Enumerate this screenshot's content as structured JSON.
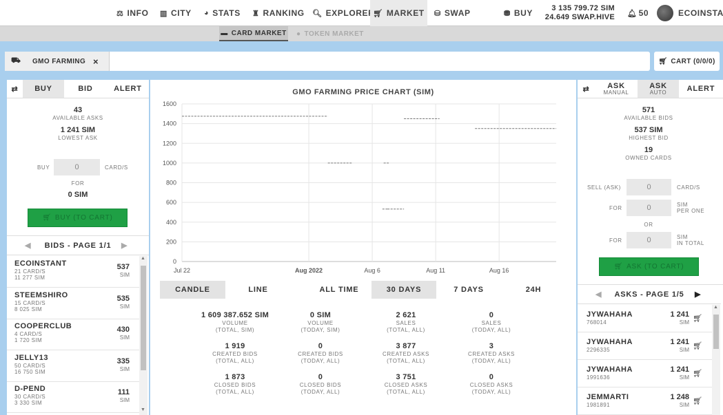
{
  "nav": {
    "items": [
      {
        "label": "INFO",
        "icon": "scale-icon"
      },
      {
        "label": "CITY",
        "icon": "city-icon"
      },
      {
        "label": "STATS",
        "icon": "pie-chart-icon"
      },
      {
        "label": "RANKING",
        "icon": "trophy-icon"
      },
      {
        "label": "EXPLORER",
        "icon": "search-icon"
      },
      {
        "label": "MARKET",
        "icon": "cart-icon"
      },
      {
        "label": "SWAP",
        "icon": "coins-icon"
      }
    ],
    "buy_label": "BUY",
    "balance_sim": "3 135 799.72 SIM",
    "balance_swap": "24.649 SWAP.HIVE",
    "notif_count": "50",
    "username": "ECOINSTAN"
  },
  "subnav": {
    "card_market": "CARD MARKET",
    "token_market": "TOKEN MARKET"
  },
  "filter": {
    "tag_label": "GMO FARMING",
    "clear": "×",
    "search_placeholder": "",
    "cart_label": "CART (0/0/0)"
  },
  "left": {
    "tabs": [
      "BUY",
      "BID",
      "ALERT"
    ],
    "available_asks": "43",
    "available_asks_label": "AVAILABLE ASKS",
    "lowest_ask": "1 241 SIM",
    "lowest_ask_label": "LOWEST ASK",
    "buy_label": "BUY",
    "buy_value": "0",
    "cards_label": "CARD/S",
    "for_label": "FOR",
    "total": "0 SIM",
    "buy_button": "BUY (TO CART)",
    "pager": "BIDS - PAGE 1/1",
    "bids": [
      {
        "name": "ECOINSTANT",
        "cards": "21 CARD/S",
        "total": "11 277 SIM",
        "price": "537",
        "unit": "SIM"
      },
      {
        "name": "STEEMSHIRO",
        "cards": "15 CARD/S",
        "total": "8 025 SIM",
        "price": "535",
        "unit": "SIM"
      },
      {
        "name": "COOPERCLUB",
        "cards": "4 CARD/S",
        "total": "1 720 SIM",
        "price": "430",
        "unit": "SIM"
      },
      {
        "name": "JELLY13",
        "cards": "50 CARD/S",
        "total": "16 750 SIM",
        "price": "335",
        "unit": "SIM"
      },
      {
        "name": "D-PEND",
        "cards": "30 CARD/S",
        "total": "3 330 SIM",
        "price": "111",
        "unit": "SIM"
      }
    ]
  },
  "chart_data": {
    "type": "line",
    "title": "GMO FARMING PRICE CHART (SIM)",
    "yticks": [
      "0",
      "200",
      "400",
      "600",
      "800",
      "1000",
      "1200",
      "1400",
      "1600"
    ],
    "ylim": [
      0,
      1600
    ],
    "xticks": [
      "Jul 22",
      "Aug 2022",
      "Aug 6",
      "Aug 11",
      "Aug 16"
    ],
    "xtick_days": [
      0,
      10,
      15,
      20,
      25
    ],
    "xlim": [
      0,
      29.5
    ],
    "series": [
      {
        "values": [
          [
            0,
            1475
          ],
          [
            11.5,
            1475
          ],
          [
            11.5,
            1000
          ],
          [
            13.4,
            1000
          ],
          [
            13.4,
            533
          ],
          [
            15.8,
            533
          ],
          [
            16.2,
            533
          ],
          [
            17.5,
            533
          ],
          [
            17.5,
            1450
          ],
          [
            20.3,
            1450
          ],
          [
            20.3,
            1475
          ],
          [
            21.5,
            1475
          ],
          [
            21.5,
            533
          ],
          [
            23.1,
            533
          ],
          [
            23.1,
            1350
          ],
          [
            29.5,
            1350
          ]
        ],
        "gaps": [
          [
            4,
            5
          ],
          [
            7,
            8
          ],
          [
            10,
            11
          ],
          [
            12,
            13
          ]
        ]
      },
      {
        "values": [
          [
            15.9,
            1000
          ],
          [
            16.3,
            1000
          ]
        ]
      }
    ],
    "grid": true
  },
  "chart_controls": {
    "types": [
      "CANDLE",
      "LINE"
    ],
    "ranges": [
      "ALL TIME",
      "30 DAYS",
      "7 DAYS",
      "24H"
    ],
    "active_range": "30 DAYS",
    "active_type": "CANDLE"
  },
  "chart_stats": [
    {
      "v": "1 609 387.652 SIM",
      "l1": "VOLUME",
      "l2": "(TOTAL, SIM)"
    },
    {
      "v": "0 SIM",
      "l1": "VOLUME",
      "l2": "(TODAY, SIM)"
    },
    {
      "v": "2 621",
      "l1": "SALES",
      "l2": "(TOTAL, ALL)"
    },
    {
      "v": "0",
      "l1": "SALES",
      "l2": "(TODAY, ALL)"
    },
    {
      "v": "1 919",
      "l1": "CREATED BIDS",
      "l2": "(TOTAL, ALL)"
    },
    {
      "v": "0",
      "l1": "CREATED BIDS",
      "l2": "(TODAY, ALL)"
    },
    {
      "v": "3 877",
      "l1": "CREATED ASKS",
      "l2": "(TOTAL, ALL)"
    },
    {
      "v": "3",
      "l1": "CREATED ASKS",
      "l2": "(TODAY, ALL)"
    },
    {
      "v": "1 873",
      "l1": "CLOSED BIDS",
      "l2": "(TOTAL, ALL)"
    },
    {
      "v": "0",
      "l1": "CLOSED BIDS",
      "l2": "(TODAY, ALL)"
    },
    {
      "v": "3 751",
      "l1": "CLOSED ASKS",
      "l2": "(TOTAL, ALL)"
    },
    {
      "v": "0",
      "l1": "CLOSED ASKS",
      "l2": "(TODAY, ALL)"
    }
  ],
  "right": {
    "tab_ask": "ASK",
    "tab_ask_sub1": "MANUAL",
    "tab_ask_sub2": "AUTO",
    "tab_alert": "ALERT",
    "available_bids": "571",
    "available_bids_label": "AVAILABLE BIDS",
    "highest_bid": "537 SIM",
    "highest_bid_label": "HIGHEST BID",
    "owned": "19",
    "owned_label": "OWNED CARDS",
    "sell_label": "SELL (ASK)",
    "sell_value": "0",
    "cards_label": "CARD/S",
    "for_label": "FOR",
    "per_one_value": "0",
    "sim_label": "SIM",
    "per_one_label": "PER ONE",
    "or_label": "OR",
    "total_value": "0",
    "in_total_label": "IN TOTAL",
    "ask_button": "ASK (TO CART)",
    "pager": "ASKS - PAGE 1/5",
    "asks": [
      {
        "name": "JYWAHAHA",
        "id": "768014",
        "price": "1 241",
        "unit": "SIM"
      },
      {
        "name": "JYWAHAHA",
        "id": "2296335",
        "price": "1 241",
        "unit": "SIM"
      },
      {
        "name": "JYWAHAHA",
        "id": "1991636",
        "price": "1 241",
        "unit": "SIM"
      },
      {
        "name": "JEMMARTI",
        "id": "1981891",
        "price": "1 248",
        "unit": "SIM"
      }
    ]
  }
}
